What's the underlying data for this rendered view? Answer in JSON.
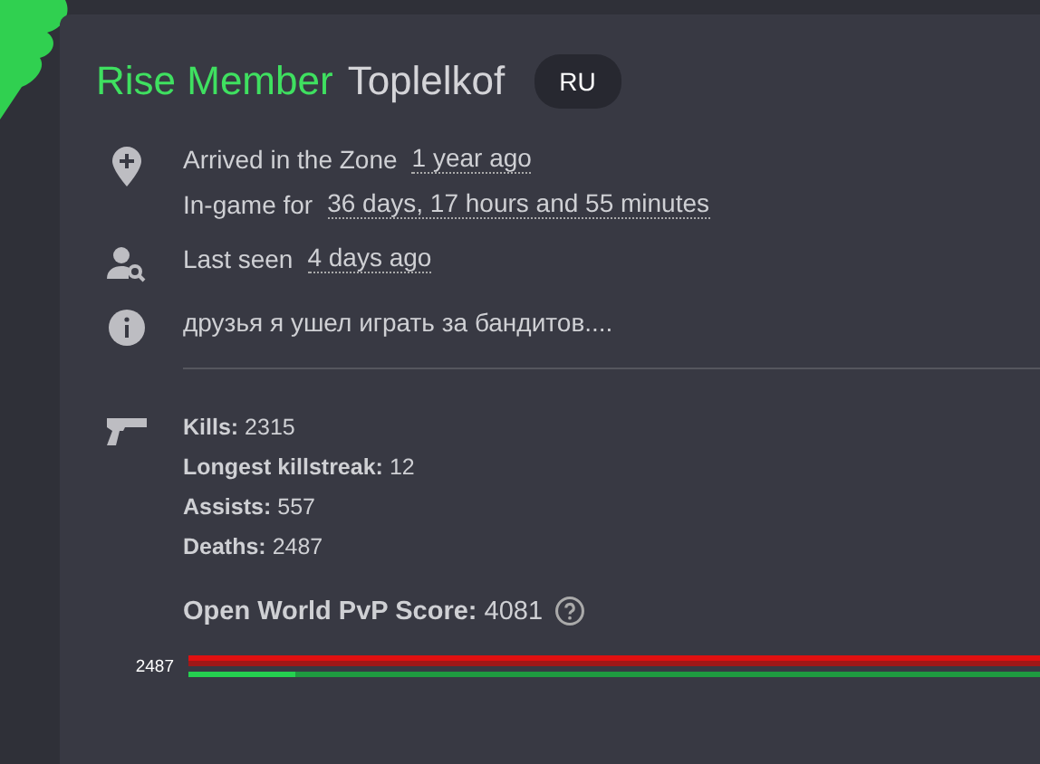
{
  "profile": {
    "rank": "Rise Member",
    "name": "Toplelkof",
    "region": "RU"
  },
  "info": [
    {
      "kind": "arrived",
      "lines": [
        {
          "label": "Arrived in the Zone",
          "value": "1 year ago"
        },
        {
          "label": "In-game for",
          "value": "36 days, 17 hours and 55 minutes"
        }
      ]
    },
    {
      "kind": "seen",
      "lines": [
        {
          "label": "Last seen",
          "value": "4 days ago"
        }
      ]
    },
    {
      "kind": "status",
      "lines": [
        {
          "label": "друзья я ушел играть за бандитов...."
        }
      ]
    }
  ],
  "stats": [
    {
      "label": "Kills:",
      "value": "2315"
    },
    {
      "label": "Longest killstreak:",
      "value": "12"
    },
    {
      "label": "Assists:",
      "value": "557"
    },
    {
      "label": "Deaths:",
      "value": "2487"
    }
  ],
  "score": {
    "label": "Open World PvP Score:",
    "value": "4081"
  },
  "bar": {
    "label": "2487",
    "level": 0.12
  }
}
